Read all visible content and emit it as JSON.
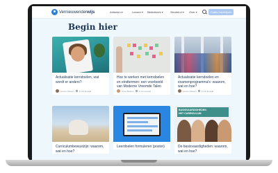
{
  "navbar": {
    "logo_light": "Vernieuwender",
    "logo_bold": "wijs",
    "items": [
      {
        "label": "Artikelen",
        "has_dropdown": true
      },
      {
        "label": "Lessen",
        "has_dropdown": true
      },
      {
        "label": "Bibliotheek",
        "has_dropdown": true
      },
      {
        "label": "Sleutelrol",
        "has_dropdown": true
      },
      {
        "label": "Over",
        "has_dropdown": true
      }
    ],
    "cta_label": "Gratis Inschrijven"
  },
  "page": {
    "title": "Begin hier"
  },
  "cards": [
    {
      "title": "Actualisatie kerndoelen, wat wordt er anders?",
      "author": "Hanne Nielsen",
      "read_time": "3 min leestijd"
    },
    {
      "title": "Hoe te werken met kerndoelen en eindtermen: een voorbeeld van Moderne Vreemde Talen",
      "author": "Anne Meijers",
      "read_time": "4 min leestijd"
    },
    {
      "title": "Actualisatie kerndoelen en examenprogramma's: waarom, wat en hoe?",
      "author": "Hanne Nielsen",
      "read_time": "3 min leestijd"
    },
    {
      "title": "Curriculumbewustzijn: waarom, wat en hoe?"
    },
    {
      "title": "Leerdoelen formuleren (poster)"
    },
    {
      "title": "De basisvaardigheden: waarom, wat en hoe?",
      "image_banner": "BASISVAARDIGHEDEN\nHET CURRICULUM"
    }
  ],
  "colors": {
    "accent": "#2d7fd3",
    "title": "#1d3557",
    "page_bg": "#eef7fb",
    "cta_bg": "#a9c9f2"
  },
  "icons": [
    "logo-icon",
    "chevron-down-icon",
    "search-icon",
    "clock-icon"
  ]
}
